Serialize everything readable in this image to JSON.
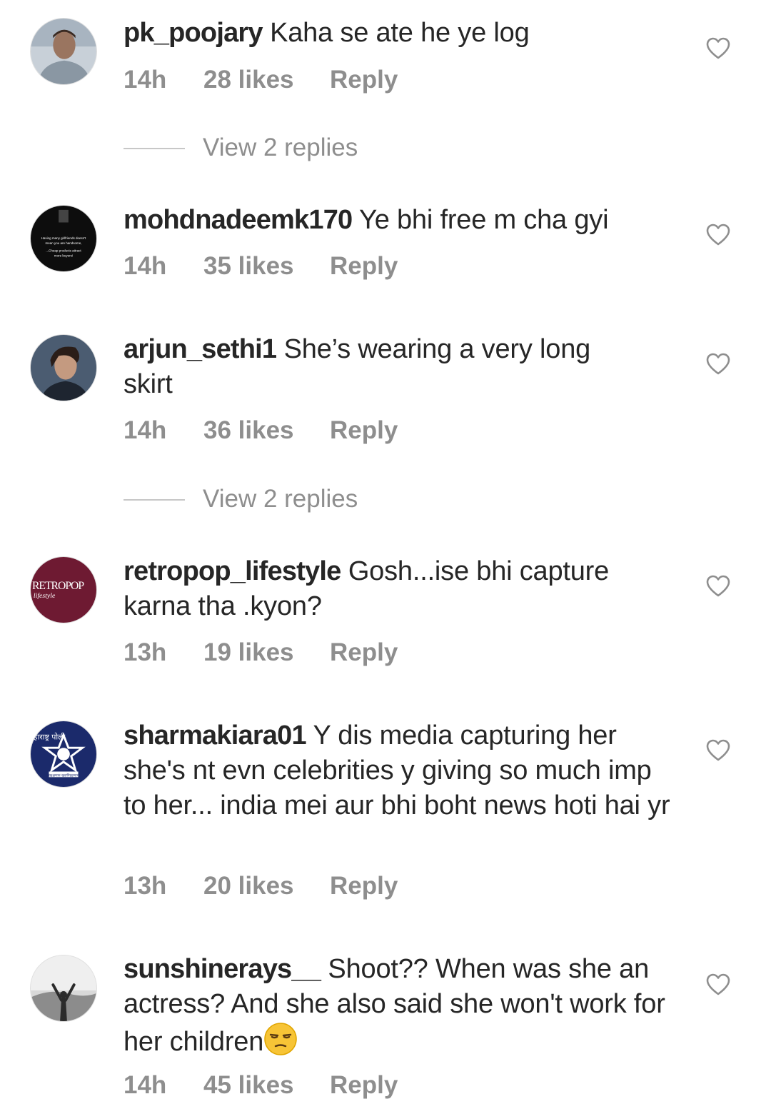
{
  "comments": [
    {
      "username": "pk_poojary",
      "text": " Kaha se ate he ye log",
      "time": "14h",
      "likes": "28 likes",
      "reply": "Reply",
      "view_replies": "View 2 replies"
    },
    {
      "username": "mohdnadeemk170",
      "text": " Ye bhi free m cha gyi",
      "time": "14h",
      "likes": "35 likes",
      "reply": "Reply",
      "avatar_text": [
        "Having many girlfriends doesn't",
        "mean you are handsome,",
        "...Cheap products attract",
        "more buyers!"
      ]
    },
    {
      "username": "arjun_sethi1",
      "text": " She’s wearing a very long skirt",
      "time": "14h",
      "likes": "36 likes",
      "reply": "Reply",
      "view_replies": "View 2 replies"
    },
    {
      "username": "retropop_lifestyle",
      "text": " Gosh...ise bhi capture karna tha .kyon?",
      "time": "13h",
      "likes": "19 likes",
      "reply": "Reply",
      "avatar_text": [
        "RETROPOP",
        "lifestyle"
      ]
    },
    {
      "username": "sharmakiara01",
      "text": " Y dis media capturing her she's nt evn celebrities y giving so much imp to her... india mei aur bhi boht news hoti hai yr",
      "time": "13h",
      "likes": "20 likes",
      "reply": "Reply",
      "avatar_text": [
        "हाराष्ट्र पोली",
        "सद्रक्षणाय खलनिग्रहणाय"
      ]
    },
    {
      "username": "sunshinerays__",
      "text": " Shoot?? When was she an actress? And she also said she won't work for her children",
      "time": "14h",
      "likes": "45 likes",
      "reply": "Reply",
      "emoji": "unamused-face"
    }
  ],
  "colors": {
    "text": "#262626",
    "meta": "#8e8e8e",
    "divider": "#c7c7c7",
    "heart": "#8e8e8e",
    "retropop_bg": "#6e1a32"
  },
  "icons": {
    "like": "heart-outline-icon"
  }
}
